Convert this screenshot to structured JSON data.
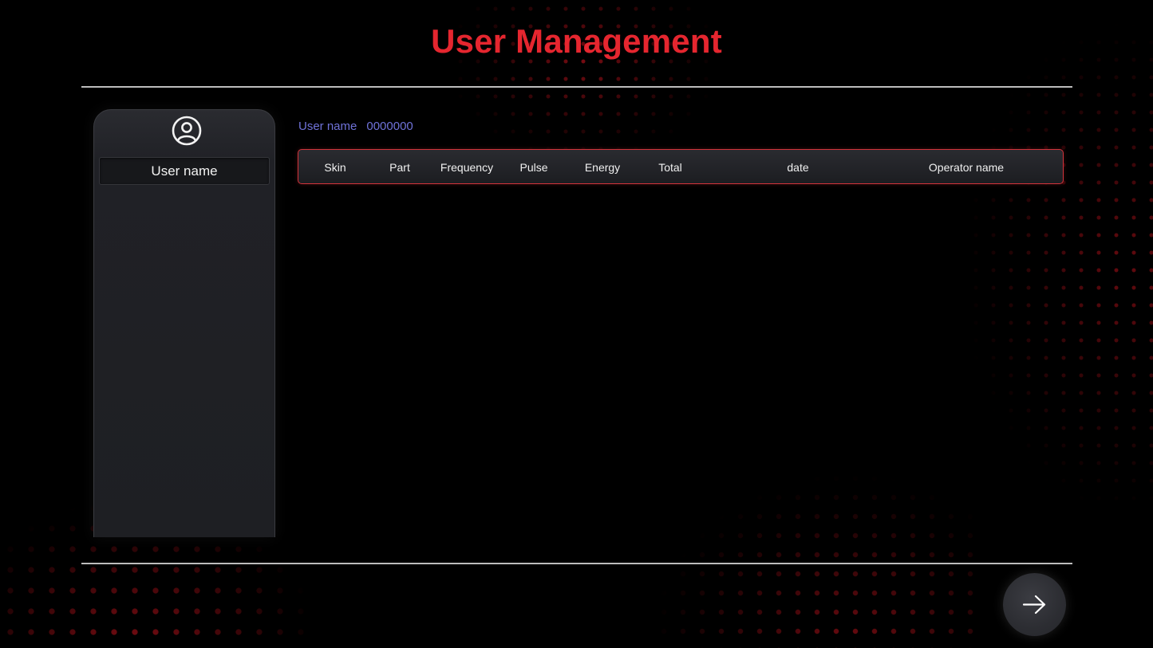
{
  "page": {
    "title": "User Management"
  },
  "sidebar": {
    "avatar_icon": "user-circle-icon",
    "user_name_label": "User name"
  },
  "user_info": {
    "label": "User name",
    "value": "0000000"
  },
  "table": {
    "columns": [
      "Skin",
      "Part",
      "Frequency",
      "Pulse",
      "Energy",
      "Total",
      "date",
      "Operator name"
    ],
    "rows": []
  },
  "actions": {
    "next_icon": "arrow-right-icon"
  },
  "colors": {
    "accent": "#e5262f",
    "info_text": "#6f72d8",
    "background": "#000000",
    "panel": "#1e1f23"
  }
}
